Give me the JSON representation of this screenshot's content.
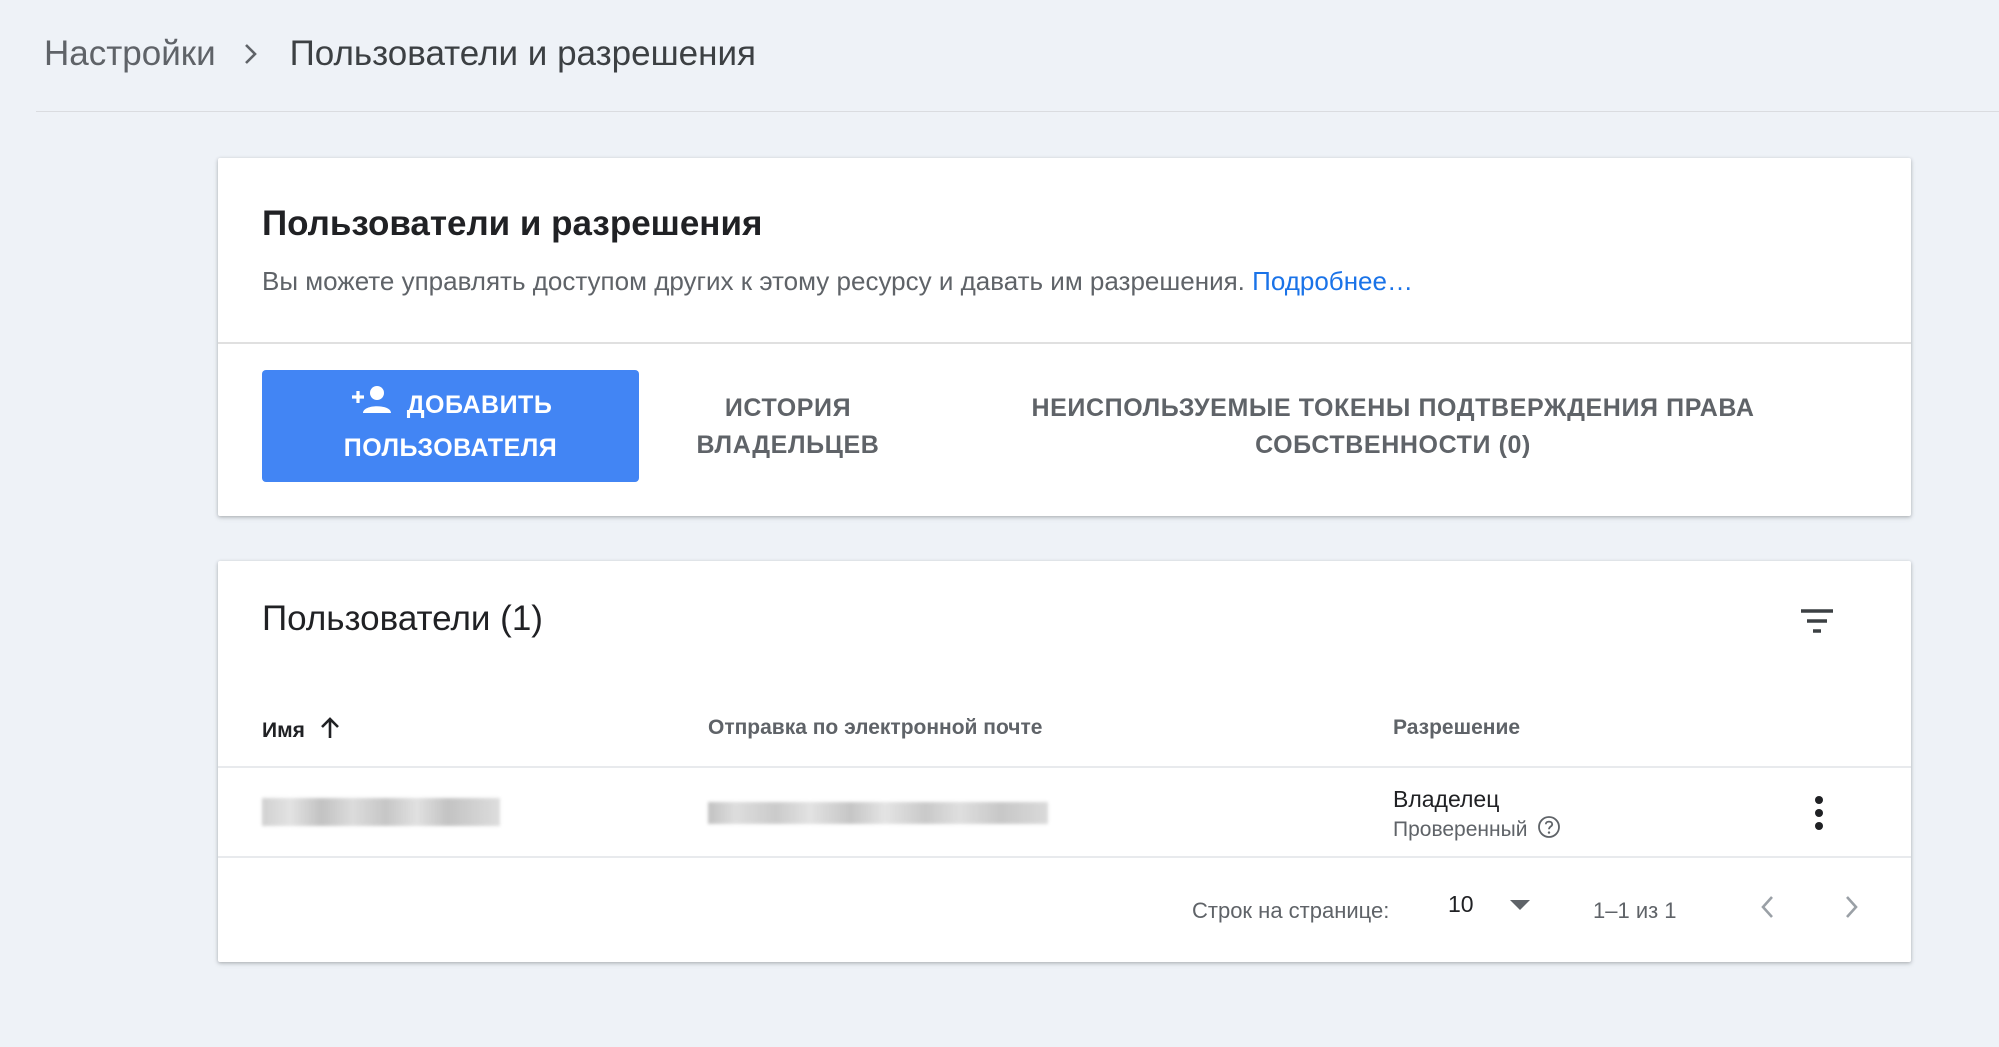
{
  "breadcrumb": {
    "parent": "Настройки",
    "current": "Пользователи и разрешения"
  },
  "info_card": {
    "title": "Пользователи и разрешения",
    "description": "Вы можете управлять доступом других к этому ресурсу и давать им разрешения.",
    "learn_more": "Подробнее…",
    "add_user_line1": "ДОБАВИТЬ",
    "add_user_line2": "ПОЛЬЗОВАТЕЛЯ",
    "owner_history_line1": "ИСТОРИЯ",
    "owner_history_line2": "ВЛАДЕЛЬЦЕВ",
    "unused_tokens_line1": "НЕИСПОЛЬЗУЕМЫЕ ТОКЕНЫ ПОДТВЕРЖДЕНИЯ ПРАВА",
    "unused_tokens_line2": "СОБСТВЕННОСТИ (0)"
  },
  "users_card": {
    "title": "Пользователи (1)",
    "columns": {
      "name": "Имя",
      "email": "Отправка по электронной почте",
      "permission": "Разрешение"
    },
    "rows": [
      {
        "permission": "Владелец",
        "status": "Проверенный"
      }
    ],
    "pagination": {
      "rows_per_page_label": "Строк на странице:",
      "rows_per_page_value": "10",
      "range": "1–1 из 1"
    }
  },
  "icons": {
    "breadcrumb_separator": "chevron-right-icon",
    "add_user": "person-add-icon",
    "sort": "arrow-up-icon",
    "filter": "filter-list-icon",
    "help": "help-outline-icon",
    "more": "more-vert-icon",
    "dropdown": "arrow-drop-down-icon",
    "prev": "chevron-left-icon",
    "next": "chevron-right-icon"
  },
  "colors": {
    "background": "#eef2f7",
    "primary_button": "#4285f4",
    "link": "#1a73e8"
  }
}
